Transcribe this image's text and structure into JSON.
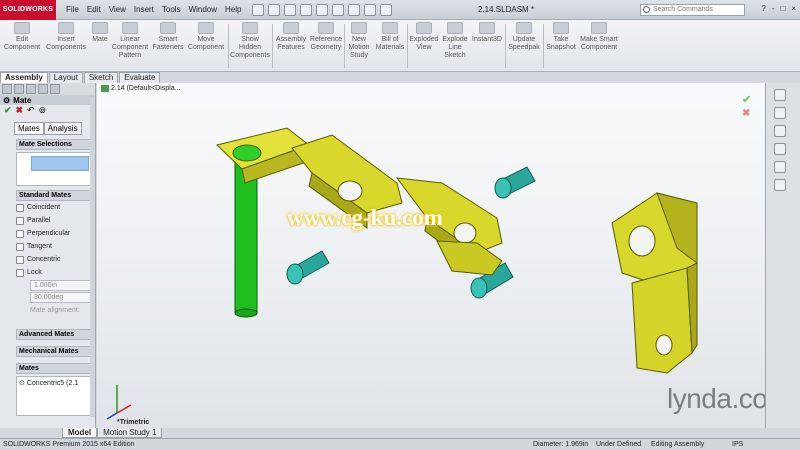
{
  "app": {
    "logo_text": "SOLIDWORKS",
    "document_title": "2.14.SLDASM *",
    "search_placeholder": "Search Commands",
    "window_controls": [
      "?",
      "-",
      "□",
      "×"
    ]
  },
  "menu": [
    "File",
    "Edit",
    "View",
    "Insert",
    "Tools",
    "Window",
    "Help"
  ],
  "command_manager": [
    {
      "label": "Edit\nComponent"
    },
    {
      "label": "Insert\nComponents"
    },
    {
      "label": "Mate"
    },
    {
      "label": "Linear\nComponent\nPattern"
    },
    {
      "label": "Smart\nFasteners"
    },
    {
      "label": "Move\nComponent"
    },
    {
      "label": "Show\nHidden\nComponents"
    },
    {
      "label": "Assembly\nFeatures"
    },
    {
      "label": "Reference\nGeometry"
    },
    {
      "label": "New\nMotion\nStudy"
    },
    {
      "label": "Bill of\nMaterials"
    },
    {
      "label": "Exploded\nView"
    },
    {
      "label": "Explode\nLine\nSketch"
    },
    {
      "label": "Instant3D"
    },
    {
      "label": "Update\nSpeedpak"
    },
    {
      "label": "Take\nSnapshot"
    },
    {
      "label": "Make Smart\nComponent"
    }
  ],
  "command_tabs": [
    "Assembly",
    "Layout",
    "Sketch",
    "Evaluate"
  ],
  "property_manager": {
    "title": "Mate",
    "subtabs": [
      "Mates",
      "Analysis"
    ],
    "sections": {
      "mate_selections": "Mate Selections",
      "standard_mates": "Standard Mates",
      "advanced_mates": "Advanced Mates",
      "mechanical_mates": "Mechanical Mates",
      "mates": "Mates"
    },
    "standard_mates": [
      "Coincident",
      "Parallel",
      "Perpendicular",
      "Tangent",
      "Concentric",
      "Lock"
    ],
    "distance_value": "1.000in",
    "angle_value": "30.00deg",
    "mate_alignment_label": "Mate alignment:",
    "mates_list": [
      "Concentric5 (2.1"
    ]
  },
  "viewport": {
    "tree_root": "2.14  (Default<Displa...",
    "view_orientation": "*Trimetric",
    "watermark": "www.cg-ku.com",
    "overlay_brand": "lynda.com"
  },
  "bottom_tabs": [
    "Model",
    "Motion Study 1"
  ],
  "status_bar": {
    "edition": "SOLIDWORKS Premium 2015 x64 Edition",
    "diameter": "Diameter: 1.969in",
    "definition": "Under Defined",
    "mode": "Editing Assembly",
    "units": "IPS"
  }
}
